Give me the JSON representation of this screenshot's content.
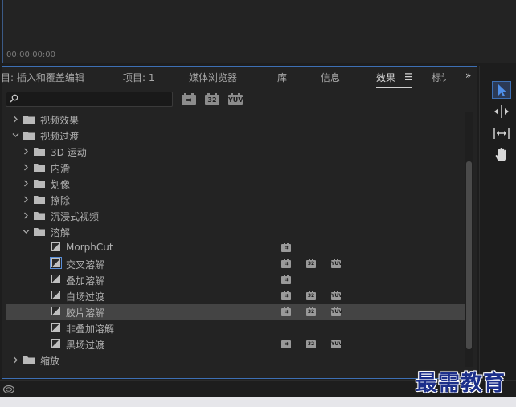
{
  "monitor": {
    "timecode": "00:00:00:00"
  },
  "tabs": [
    {
      "label": "目: 插入和覆盖编辑",
      "active": false
    },
    {
      "label": "项目: 1",
      "active": false
    },
    {
      "label": "媒体浏览器",
      "active": false
    },
    {
      "label": "库",
      "active": false
    },
    {
      "label": "信息",
      "active": false
    },
    {
      "label": "效果",
      "active": true
    },
    {
      "label": "标讠",
      "active": false
    }
  ],
  "tab_menu": "☰",
  "overflow": "»",
  "search": {
    "value": "",
    "placeholder": ""
  },
  "filter_badges": [
    "加速",
    "32",
    "YUV"
  ],
  "tree": [
    {
      "label": "视频效果",
      "type": "folder",
      "expanded": false
    },
    {
      "label": "视频过渡",
      "type": "folder",
      "expanded": true
    },
    {
      "label": "3D 运动",
      "type": "folder",
      "expanded": false
    },
    {
      "label": "内滑",
      "type": "folder",
      "expanded": false
    },
    {
      "label": "划像",
      "type": "folder",
      "expanded": false
    },
    {
      "label": "擦除",
      "type": "folder",
      "expanded": false
    },
    {
      "label": "沉浸式视频",
      "type": "folder",
      "expanded": false
    },
    {
      "label": "溶解",
      "type": "folder",
      "expanded": true
    },
    {
      "label": "MorphCut",
      "type": "effect",
      "badges": [
        "accel"
      ]
    },
    {
      "label": "交叉溶解",
      "type": "effect",
      "badges": [
        "accel",
        "32",
        "yuv"
      ]
    },
    {
      "label": "叠加溶解",
      "type": "effect",
      "badges": [
        "accel"
      ]
    },
    {
      "label": "白场过渡",
      "type": "effect",
      "badges": [
        "accel",
        "32",
        "yuv"
      ]
    },
    {
      "label": "胶片溶解",
      "type": "effect",
      "badges": [
        "accel",
        "32",
        "yuv"
      ],
      "selected": true
    },
    {
      "label": "非叠加溶解",
      "type": "effect",
      "badges": []
    },
    {
      "label": "黑场过渡",
      "type": "effect",
      "badges": [
        "accel",
        "32",
        "yuv"
      ]
    },
    {
      "label": "缩放",
      "type": "folder",
      "expanded": false
    }
  ],
  "badge_text": {
    "accel": "⇉",
    "32": "32",
    "yuv": "YUV"
  },
  "watermark": "最需教育",
  "colors": {
    "accent": "#3d6fb4",
    "selected_row": "#444444",
    "watermark": "#1c2f8a"
  }
}
